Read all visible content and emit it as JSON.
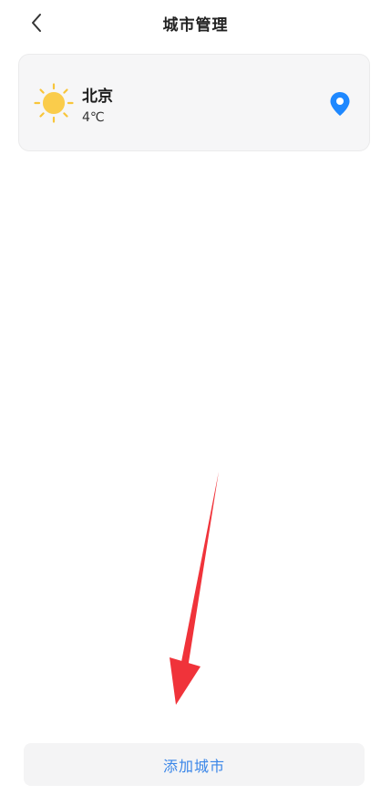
{
  "header": {
    "back_icon": "chevron-left-icon",
    "title": "城市管理"
  },
  "cities": [
    {
      "name": "北京",
      "temperature": "4℃",
      "weather_icon": "sun-icon",
      "location_icon": "location-pin-icon"
    }
  ],
  "footer": {
    "add_city_label": "添加城市"
  },
  "colors": {
    "accent": "#3a86e8",
    "location_pin": "#1e88ff",
    "sun": "#f8c53a",
    "card_bg": "#f6f6f7",
    "annotation_arrow": "#f0333a"
  }
}
